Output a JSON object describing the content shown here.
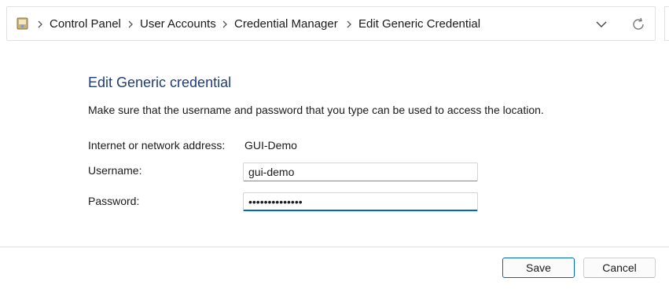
{
  "breadcrumb": {
    "icon": "control-panel-icon",
    "items": [
      {
        "label": "Control Panel"
      },
      {
        "label": "User Accounts"
      },
      {
        "label": "Credential Manager"
      },
      {
        "label": "Edit Generic Credential"
      }
    ],
    "dropdown_icon": "chevron-down-icon",
    "refresh_icon": "refresh-icon"
  },
  "form": {
    "title": "Edit Generic credential",
    "instructions": "Make sure that the username and password that you type can be used to access the location.",
    "address_label": "Internet or network address:",
    "address_value": "GUI-Demo",
    "username_label": "Username:",
    "username_value": "gui-demo",
    "password_label": "Password:",
    "password_value": "••••••••••••••"
  },
  "buttons": {
    "save_label": "Save",
    "cancel_label": "Cancel"
  },
  "colors": {
    "title": "#1f3d7a",
    "accent": "#0067c0"
  }
}
